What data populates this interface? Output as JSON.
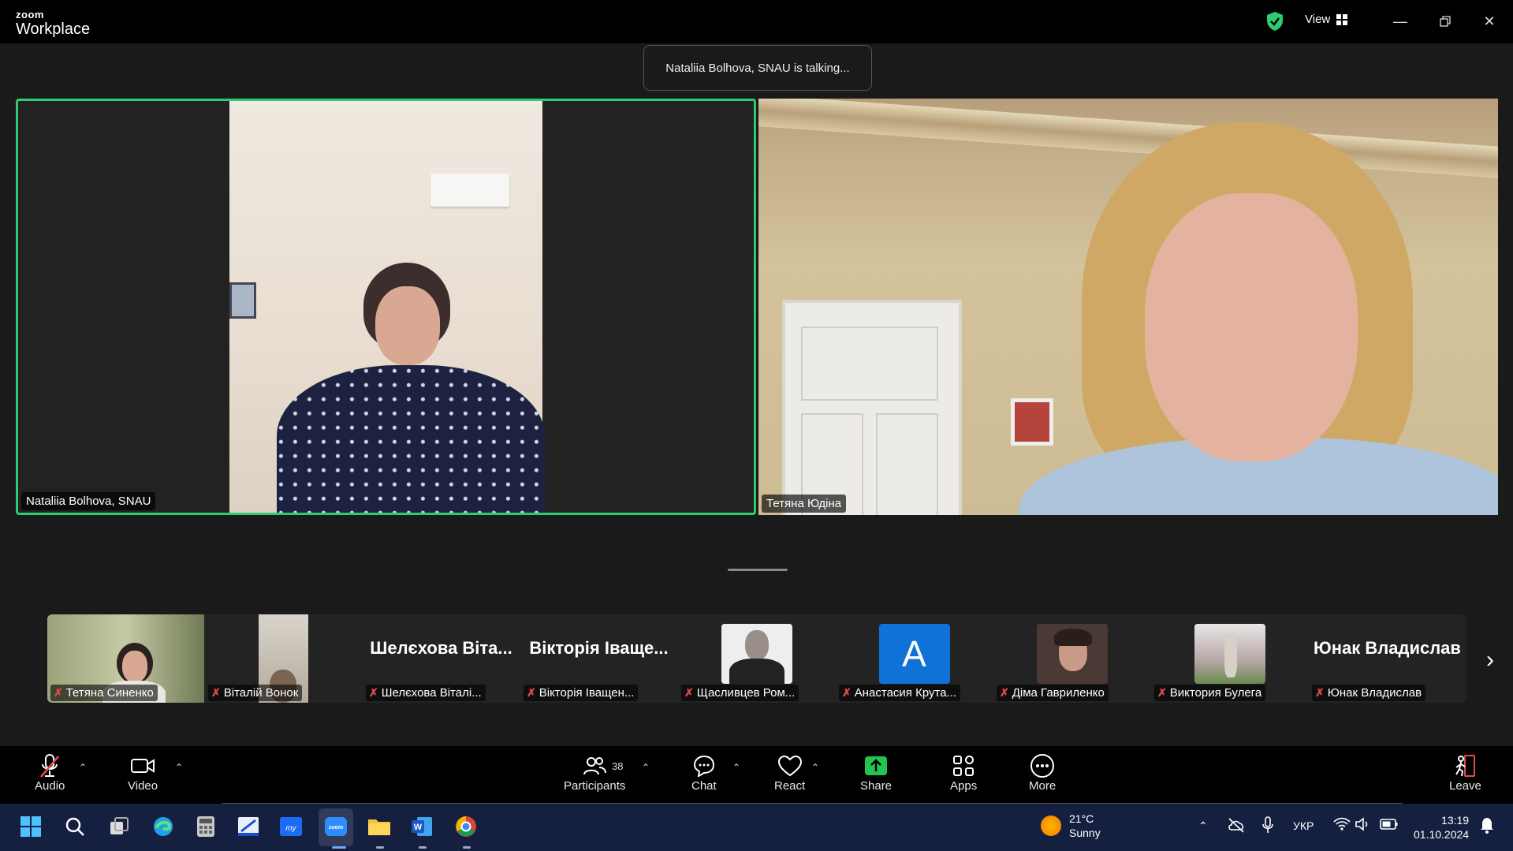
{
  "app": {
    "brand_small": "zoom",
    "brand_large": "Workplace",
    "view_label": "View"
  },
  "toast": "Nataliia Bolhova, SNAU is talking...",
  "main_tiles": [
    {
      "name": "Nataliia Bolhova, SNAU"
    },
    {
      "name": "Тетяна Юдіна"
    }
  ],
  "thumbnails": [
    {
      "label": "Тетяна Синенко",
      "display": "video"
    },
    {
      "label": "Віталій Вонок",
      "display": "video"
    },
    {
      "label": "Шелєхова Віталі...",
      "big_name": "Шелєхова Віта...",
      "display": "name"
    },
    {
      "label": "Вікторія Іващен...",
      "big_name": "Вікторія Іваще...",
      "display": "name"
    },
    {
      "label": "Щасливцев Ром...",
      "display": "avatar"
    },
    {
      "label": "Анастасия Крута...",
      "avatar_letter": "A",
      "display": "letter"
    },
    {
      "label": "Діма Гавриленко",
      "display": "avatar"
    },
    {
      "label": "Виктория Булега",
      "display": "avatar"
    },
    {
      "label": "Юнак Владислав",
      "big_name": "Юнак Владислав",
      "display": "name"
    }
  ],
  "toolbar": {
    "audio": "Audio",
    "video": "Video",
    "participants": "Participants",
    "participants_count": "38",
    "chat": "Chat",
    "react": "React",
    "share": "Share",
    "apps": "Apps",
    "more": "More",
    "leave": "Leave"
  },
  "taskbar": {
    "weather_temp": "21°C",
    "weather_desc": "Sunny",
    "language": "УКР",
    "time": "13:19",
    "date": "01.10.2024"
  },
  "colors": {
    "active_speaker": "#2ecc71",
    "share_green": "#23c552",
    "mute_red": "#e5484d",
    "leave_red": "#e5484d"
  }
}
